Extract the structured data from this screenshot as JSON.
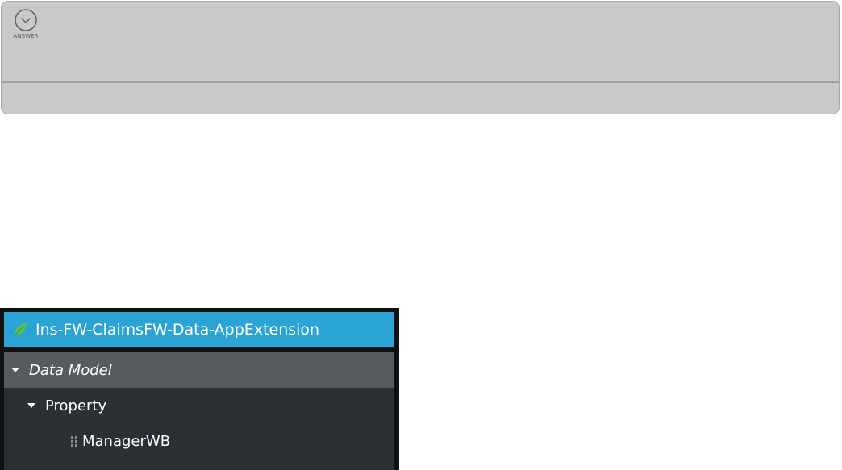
{
  "answer_panel": {
    "toggle_icon": "chevron-down-icon",
    "label": "ANSWER"
  },
  "tree": {
    "header": {
      "icon": "leaf-icon",
      "icon_color": "#5cbf5c",
      "title": "Ins-FW-ClaimsFW-Data-AppExtension",
      "background": "#2ba3d4"
    },
    "section": {
      "label": "Data Model",
      "expanded": true
    },
    "items": [
      {
        "label": "Property",
        "expanded": true
      },
      {
        "label": "ManagerWB"
      }
    ]
  }
}
